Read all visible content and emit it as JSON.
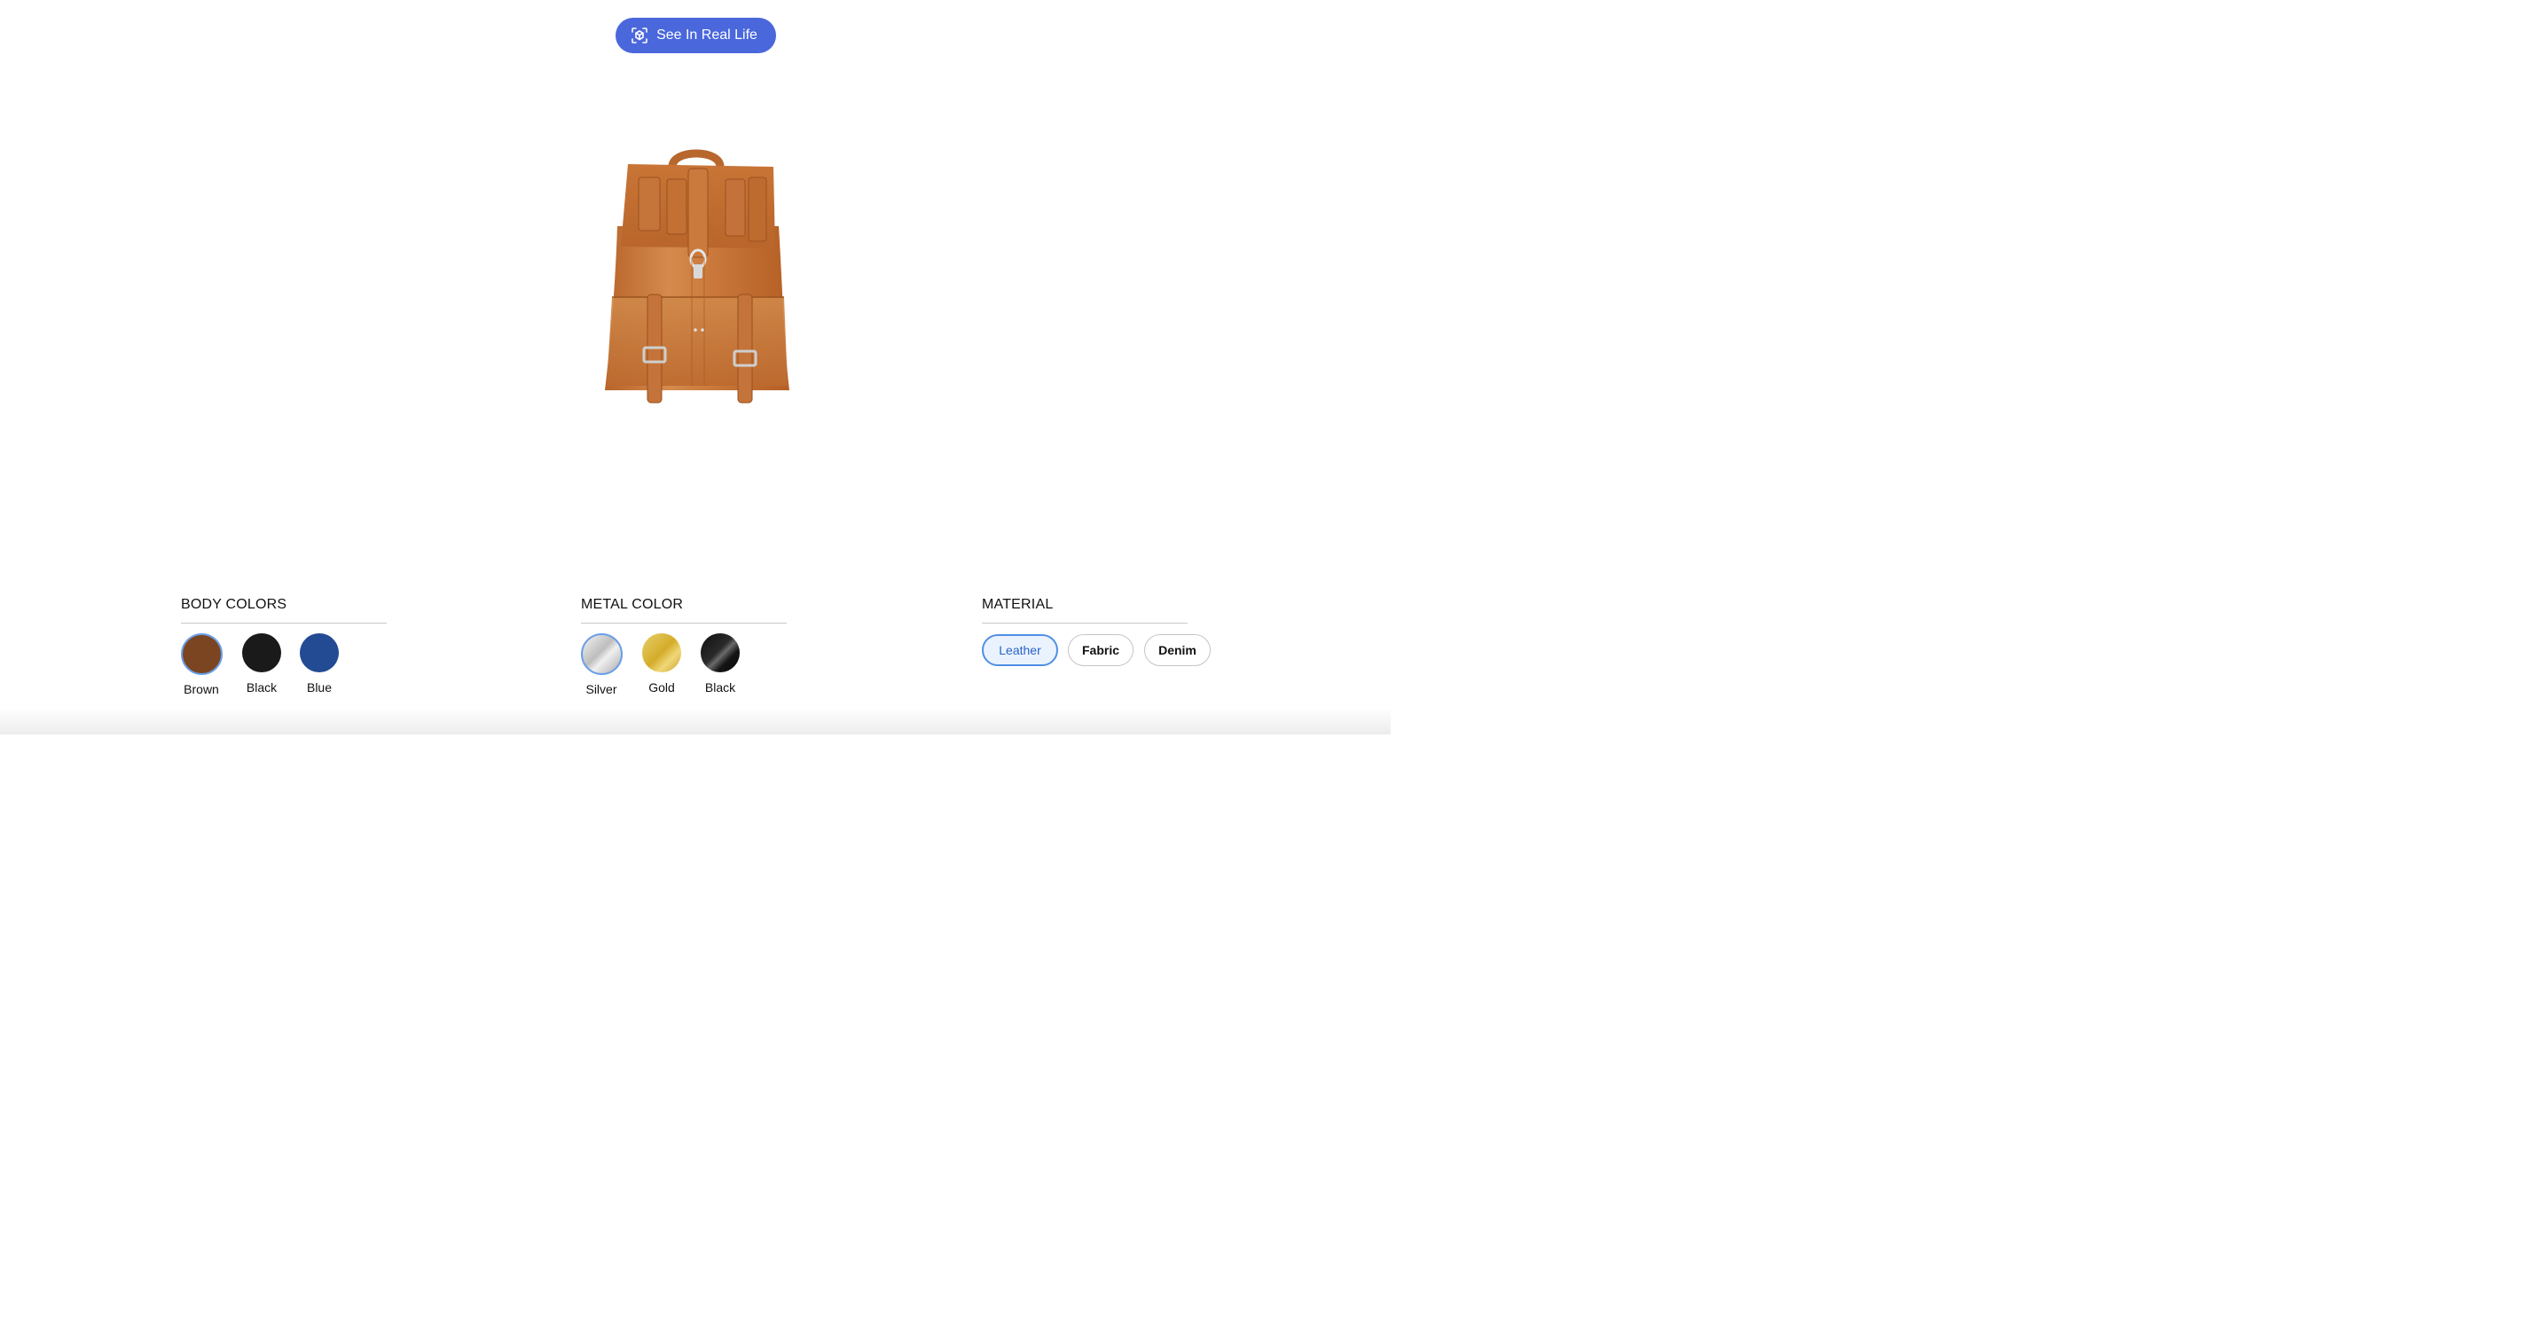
{
  "ar_button": {
    "label": "See In Real Life",
    "icon": "ar-scan-icon",
    "color": "#4a67dc"
  },
  "viewer": {
    "product": "leather-backpack-icon"
  },
  "body_colors": {
    "title": "BODY COLORS",
    "selected": "Brown",
    "options": [
      {
        "label": "Brown",
        "color": "#7a4520"
      },
      {
        "label": "Black",
        "color": "#1a1a1a"
      },
      {
        "label": "Blue",
        "color": "#224b93"
      }
    ]
  },
  "metal_color": {
    "title": "METAL COLOR",
    "selected": "Silver",
    "options": [
      {
        "label": "Silver",
        "color": "#d8d8d8"
      },
      {
        "label": "Gold",
        "color": "#d9b53a"
      },
      {
        "label": "Black",
        "color": "#141414"
      }
    ]
  },
  "material": {
    "title": "MATERIAL",
    "selected": "Leather",
    "options": [
      {
        "label": "Leather"
      },
      {
        "label": "Fabric"
      },
      {
        "label": "Denim"
      }
    ]
  },
  "accent_color": "#4f8fe6"
}
